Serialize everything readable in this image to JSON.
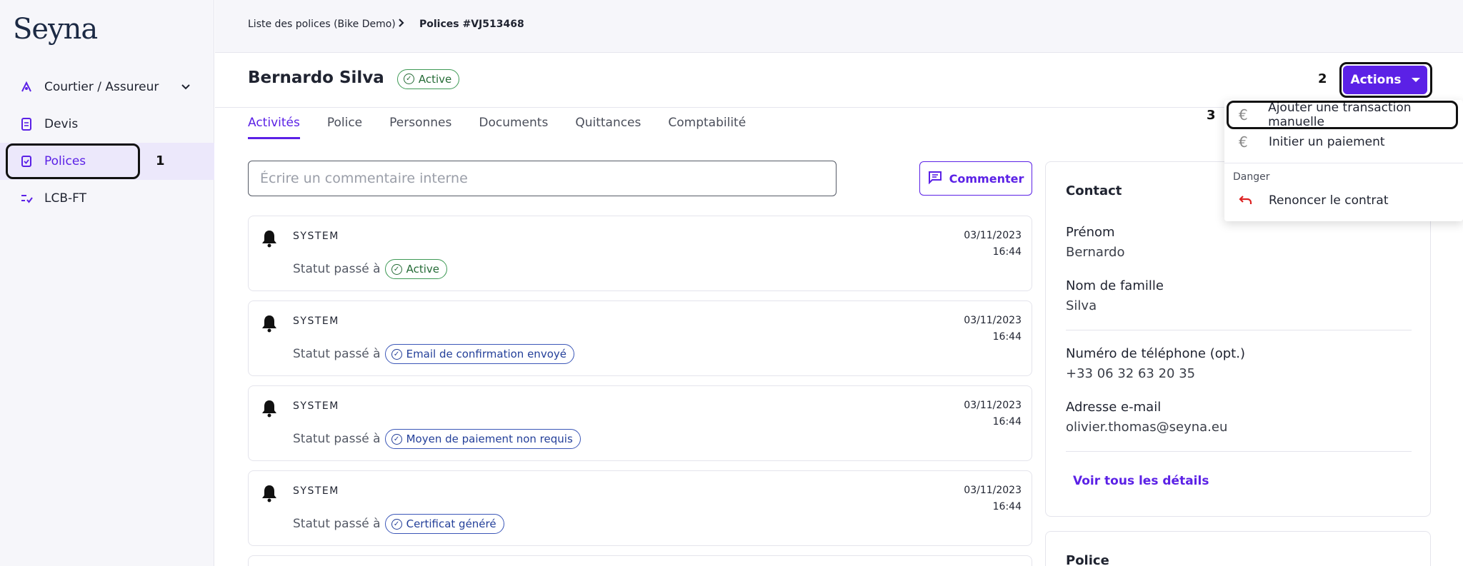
{
  "app": {
    "logo": "Seyna"
  },
  "sidebar": {
    "items": [
      {
        "label": "Courtier / Assureur",
        "icon": "broker-icon"
      },
      {
        "label": "Devis",
        "icon": "document-icon"
      },
      {
        "label": "Polices",
        "icon": "policy-icon"
      },
      {
        "label": "LCB-FT",
        "icon": "checklist-icon"
      }
    ],
    "annotation": "1"
  },
  "breadcrumb": {
    "parent": "Liste des polices (Bike Demo)",
    "current": "Polices #VJ513468"
  },
  "header": {
    "name": "Bernardo Silva",
    "status": "Active"
  },
  "tabs": [
    "Activités",
    "Police",
    "Personnes",
    "Documents",
    "Quittances",
    "Comptabilité"
  ],
  "actions": {
    "label": "Actions",
    "annotation": "2"
  },
  "dropdown": {
    "annotation": "3",
    "items": [
      {
        "label": "Ajouter une transaction manuelle",
        "icon": "euro-icon"
      },
      {
        "label": "Initier un paiement",
        "icon": "euro-icon"
      }
    ],
    "danger_group": "Danger",
    "danger_item": {
      "label": "Renoncer le contrat",
      "icon": "undo-icon"
    }
  },
  "comment": {
    "placeholder": "Écrire un commentaire interne",
    "button": "Commenter"
  },
  "activities": [
    {
      "author": "SYSTEM",
      "date": "03/11/2023",
      "time": "16:44",
      "prefix": "Statut passé à",
      "badge": "Active",
      "color": "green"
    },
    {
      "author": "SYSTEM",
      "date": "03/11/2023",
      "time": "16:44",
      "prefix": "Statut passé à",
      "badge": "Email de confirmation envoyé",
      "color": "blue"
    },
    {
      "author": "SYSTEM",
      "date": "03/11/2023",
      "time": "16:44",
      "prefix": "Statut passé à",
      "badge": "Moyen de paiement non requis",
      "color": "blue"
    },
    {
      "author": "SYSTEM",
      "date": "03/11/2023",
      "time": "16:44",
      "prefix": "Statut passé à",
      "badge": "Certificat généré",
      "color": "blue"
    }
  ],
  "contact": {
    "title": "Contact",
    "first_name_label": "Prénom",
    "first_name": "Bernardo",
    "last_name_label": "Nom de famille",
    "last_name": "Silva",
    "phone_label": "Numéro de téléphone (opt.)",
    "phone": "+33 06 32 63 20 35",
    "email_label": "Adresse e-mail",
    "email": "olivier.thomas@seyna.eu",
    "details_link": "Voir tous les détails"
  },
  "police_card": {
    "title": "Police"
  },
  "colors": {
    "accent": "#5b21e6",
    "success": "#3e9a55",
    "info": "#3b57b8",
    "danger": "#dd2222"
  }
}
